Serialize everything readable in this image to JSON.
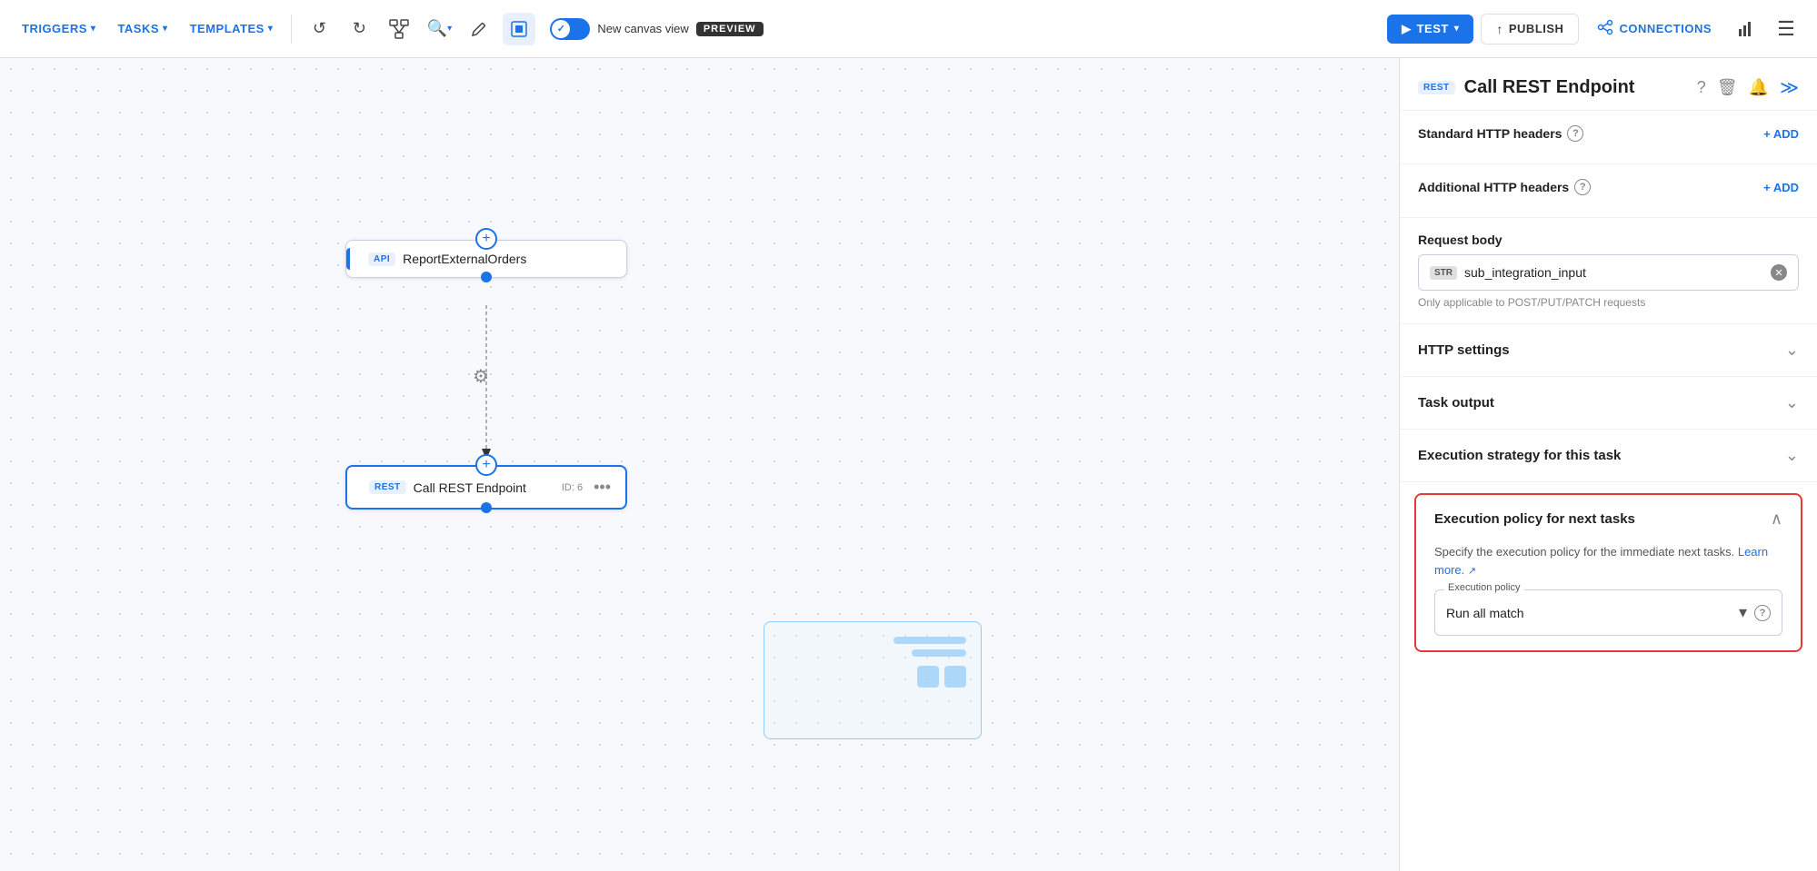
{
  "topnav": {
    "triggers_label": "TRIGGERS",
    "tasks_label": "TASKS",
    "templates_label": "TEMPLATES",
    "undo_title": "Undo",
    "redo_title": "Redo",
    "diagram_title": "Diagram",
    "zoom_title": "Zoom",
    "edit_title": "Edit",
    "canvas_title": "Canvas view",
    "new_canvas_label": "New canvas view",
    "preview_badge": "PREVIEW",
    "test_label": "TEST",
    "publish_label": "PUBLISH",
    "connections_label": "CONNECTIONS"
  },
  "canvas": {
    "node1": {
      "badge": "API",
      "label": "ReportExternalOrders"
    },
    "node2": {
      "badge": "REST",
      "label": "Call REST Endpoint",
      "id_label": "ID: 6"
    }
  },
  "right_panel": {
    "rest_badge": "REST",
    "title": "Call REST Endpoint",
    "standard_http_headers_label": "Standard HTTP headers",
    "additional_http_headers_label": "Additional HTTP headers",
    "add_label": "+ ADD",
    "request_body_label": "Request body",
    "str_badge": "STR",
    "body_value": "sub_integration_input",
    "only_applicable_note": "Only applicable to POST/PUT/PATCH requests",
    "http_settings_label": "HTTP settings",
    "task_output_label": "Task output",
    "execution_strategy_label": "Execution strategy for this task",
    "execution_policy_next_label": "Execution policy for next tasks",
    "execution_policy_desc": "Specify the execution policy for the immediate next tasks.",
    "learn_more_label": "Learn more.",
    "execution_policy_field_label": "Execution policy",
    "execution_policy_value": "Run all match"
  }
}
